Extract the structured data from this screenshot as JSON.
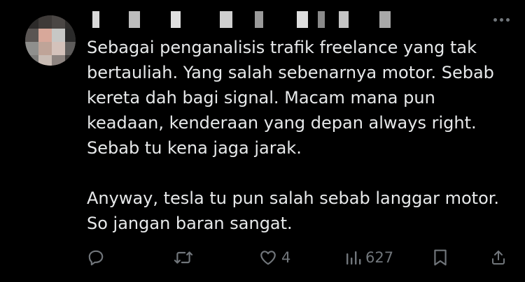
{
  "post": {
    "author_redacted": true,
    "text_paragraphs": [
      "Sebagai penganalisis trafik freelance yang tak bertauliah. Yang salah sebenarnya motor. Sebab kereta dah bagi signal. Macam mana pun keadaan, kenderaan yang depan always right. Sebab tu kena jaga jarak.",
      "Anyway, tesla tu pun salah sebab langgar motor. So jangan baran sangat."
    ]
  },
  "actions": {
    "reply_icon": "reply-icon",
    "repost_icon": "repost-icon",
    "like_icon": "like-icon",
    "like_count": "4",
    "views_icon": "views-icon",
    "views_count": "627",
    "bookmark_icon": "bookmark-icon",
    "share_icon": "share-icon"
  },
  "colors": {
    "background": "#000000",
    "text": "#e7e9ea",
    "muted": "#71767b"
  }
}
